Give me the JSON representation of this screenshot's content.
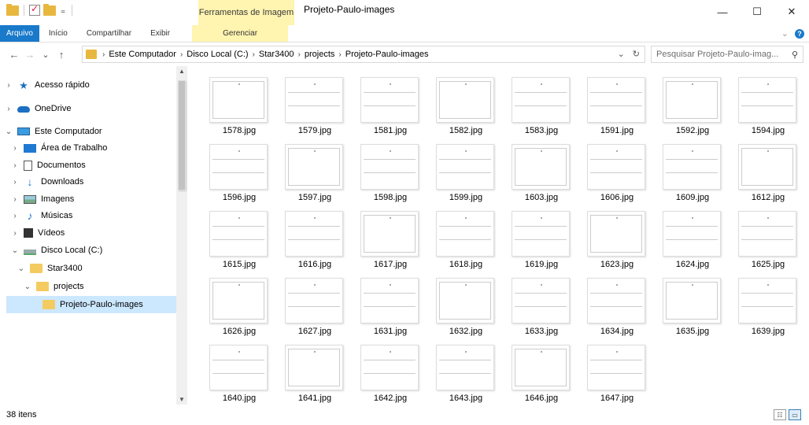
{
  "window": {
    "title": "Projeto-Paulo-images",
    "context_tab_group": "Ferramentas de Imagem",
    "controls": {
      "minimize": "—",
      "maximize": "☐",
      "close": "✕"
    }
  },
  "ribbon": {
    "tabs": [
      {
        "label": "Arquivo"
      },
      {
        "label": "Início"
      },
      {
        "label": "Compartilhar"
      },
      {
        "label": "Exibir"
      },
      {
        "label": "Gerenciar"
      }
    ],
    "expand_icon": "chevron-down",
    "help_icon": "?"
  },
  "address": {
    "back": "←",
    "forward": "→",
    "recent": "⌄",
    "up": "↑",
    "breadcrumbs": [
      "Este Computador",
      "Disco Local (C:)",
      "Star3400",
      "projects",
      "Projeto-Paulo-images"
    ],
    "dropdown": "⌄",
    "refresh": "↻",
    "search_placeholder": "Pesquisar Projeto-Paulo-imag..."
  },
  "navpane": {
    "items": [
      {
        "label": "Acesso rápido",
        "icon": "star-icon"
      },
      {
        "label": "OneDrive",
        "icon": "cloud-icon"
      },
      {
        "label": "Este Computador",
        "icon": "pc-icon"
      },
      {
        "label": "Área de Trabalho",
        "icon": "desktop-icon"
      },
      {
        "label": "Documentos",
        "icon": "document-icon"
      },
      {
        "label": "Downloads",
        "icon": "download-icon"
      },
      {
        "label": "Imagens",
        "icon": "image-icon"
      },
      {
        "label": "Músicas",
        "icon": "music-icon"
      },
      {
        "label": "Vídeos",
        "icon": "video-icon"
      },
      {
        "label": "Disco Local (C:)",
        "icon": "drive-icon"
      },
      {
        "label": "Star3400",
        "icon": "folder-icon"
      },
      {
        "label": "projects",
        "icon": "folder-icon"
      },
      {
        "label": "Projeto-Paulo-images",
        "icon": "folder-icon"
      }
    ]
  },
  "files": [
    "1578.jpg",
    "1579.jpg",
    "1581.jpg",
    "1582.jpg",
    "1583.jpg",
    "1591.jpg",
    "1592.jpg",
    "1594.jpg",
    "1596.jpg",
    "1597.jpg",
    "1598.jpg",
    "1599.jpg",
    "1603.jpg",
    "1606.jpg",
    "1609.jpg",
    "1612.jpg",
    "1615.jpg",
    "1616.jpg",
    "1617.jpg",
    "1618.jpg",
    "1619.jpg",
    "1623.jpg",
    "1624.jpg",
    "1625.jpg",
    "1626.jpg",
    "1627.jpg",
    "1631.jpg",
    "1632.jpg",
    "1633.jpg",
    "1634.jpg",
    "1635.jpg",
    "1639.jpg",
    "1640.jpg",
    "1641.jpg",
    "1642.jpg",
    "1643.jpg",
    "1646.jpg",
    "1647.jpg"
  ],
  "status": {
    "count": "38 itens"
  },
  "colors": {
    "accent": "#1979ca",
    "context_tab": "#fff4b0",
    "selection": "#cce8ff",
    "folder": "#f4cb61"
  }
}
